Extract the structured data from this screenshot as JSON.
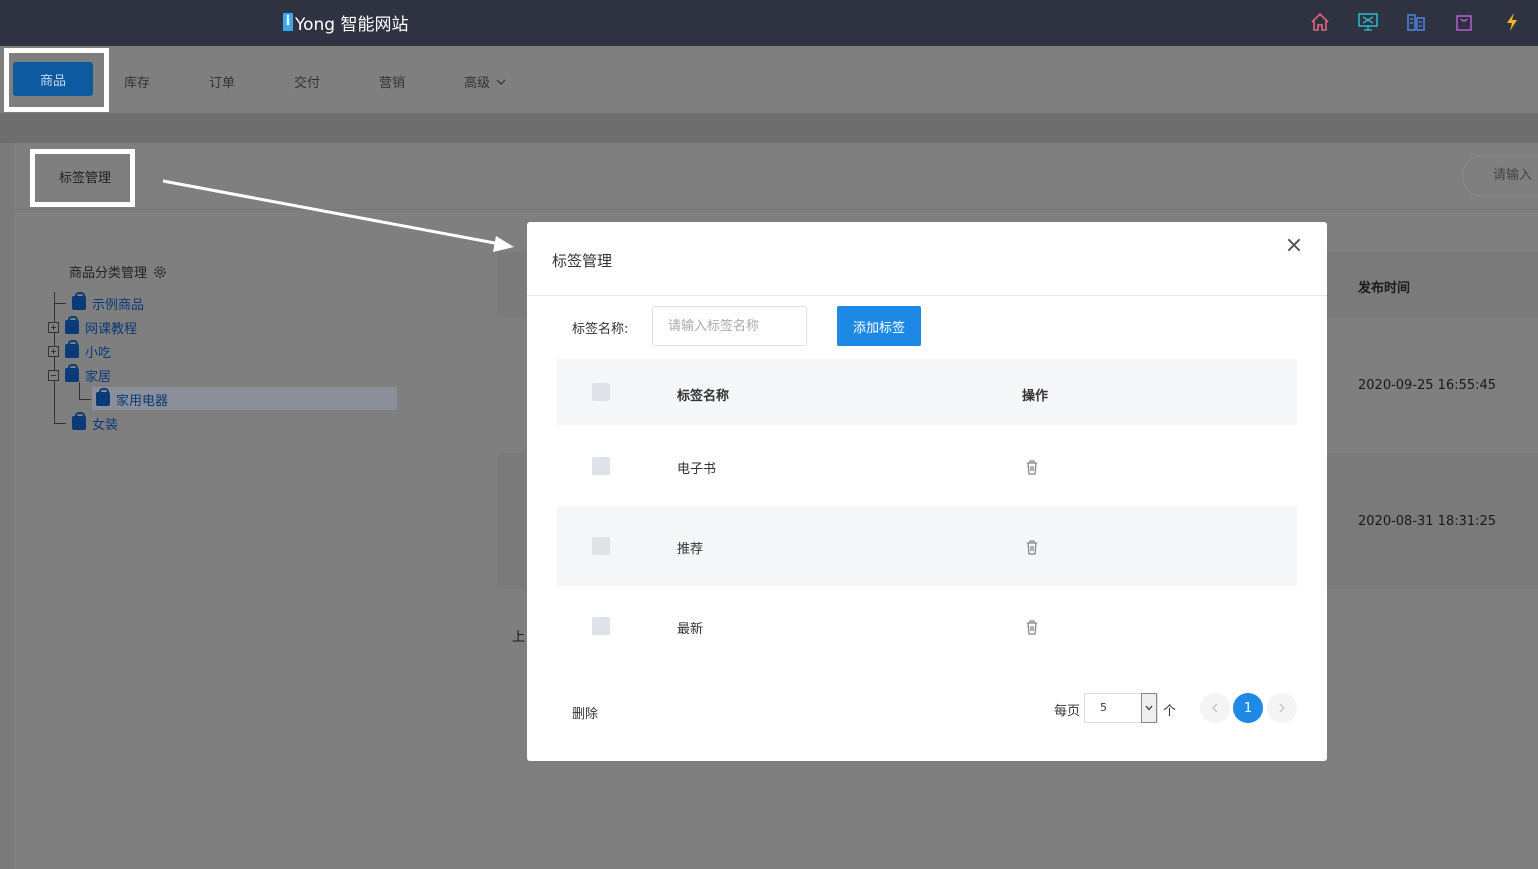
{
  "app": {
    "logo_letter": "i",
    "logo_text": "Yong 智能网站"
  },
  "top_icons": [
    "home-icon",
    "monitor-icon",
    "building-icon",
    "bag-icon",
    "lightning-icon"
  ],
  "nav": {
    "items": [
      {
        "label": "商品",
        "active": true
      },
      {
        "label": "库存"
      },
      {
        "label": "订单"
      },
      {
        "label": "交付"
      },
      {
        "label": "营销"
      },
      {
        "label": "高级"
      }
    ]
  },
  "toolbar": {
    "tag_manage_label": "标签管理",
    "search_placeholder": "请输入"
  },
  "tree": {
    "title": "商品分类管理",
    "nodes": [
      {
        "label": "示例商品"
      },
      {
        "label": "网课教程"
      },
      {
        "label": "小吃"
      },
      {
        "label": "家居"
      },
      {
        "label": "家用电器"
      },
      {
        "label": "女装"
      }
    ]
  },
  "background_table": {
    "col_publish_time": "发布时间",
    "rows": [
      {
        "publish_time": "2020-09-25 16:55:45"
      },
      {
        "publish_time": "2020-08-31 18:31:25"
      }
    ],
    "partial_text": "上"
  },
  "modal": {
    "title": "标签管理",
    "field_label": "标签名称:",
    "field_placeholder": "请输入标签名称",
    "add_button": "添加标签",
    "table": {
      "headers": [
        "标签名称",
        "操作"
      ],
      "rows": [
        {
          "name": "电子书"
        },
        {
          "name": "推荐"
        },
        {
          "name": "最新"
        }
      ]
    },
    "delete_label": "删除",
    "pagination": {
      "per_page_label": "每页",
      "page_size": "5",
      "unit_label": "个",
      "current_page": "1"
    }
  },
  "colors": {
    "topbar": "#2f3341",
    "primary": "#1e88e5",
    "nav_active": "#0d5aa0"
  }
}
